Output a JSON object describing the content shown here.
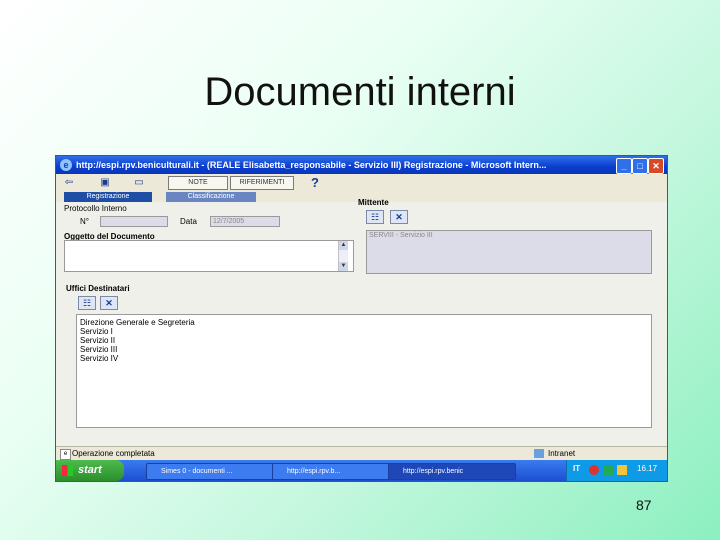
{
  "slide": {
    "title": "Documenti interni",
    "page_number": "87"
  },
  "window": {
    "title": "http://espi.rpv.beniculturali.it - (REALE Elisabetta_responsabile - Servizio III) Registrazione - Microsoft Intern...",
    "buttons": {
      "minimize": "_",
      "maximize": "□",
      "close": "✕"
    }
  },
  "toolbar": {
    "nota_label": "NOTE",
    "riferimenti_label": "RIFERIMENTI",
    "help_label": "?"
  },
  "tabs": [
    {
      "label": "Registrazione"
    },
    {
      "label": "Classificazione"
    }
  ],
  "form": {
    "protocollo_label": "Protocollo Interno",
    "numero_label": "N°",
    "numero_value": "",
    "data_label": "Data",
    "data_value": "12/7/2005",
    "oggetto_label": "Oggetto del Documento",
    "oggetto_value": "",
    "mittente_label": "Mittente",
    "mittente_value": "SERVIII - Servizio III",
    "uffici_label": "Uffici Destinatari",
    "uffici": [
      "Direzione Generale e Segreteria",
      "Servizio I",
      "Servizio II",
      "Servizio III",
      "Servizio IV"
    ]
  },
  "statusbar": {
    "text": "Operazione completata",
    "zone": "Intranet"
  },
  "taskbar": {
    "start_label": "start",
    "tasks": [
      {
        "label": "Simes 0 - documenti ..."
      },
      {
        "label": "http://espi.rpv.b..."
      },
      {
        "label": "http://espi.rpv.benic"
      }
    ],
    "lang": "IT",
    "clock": "16.17"
  }
}
